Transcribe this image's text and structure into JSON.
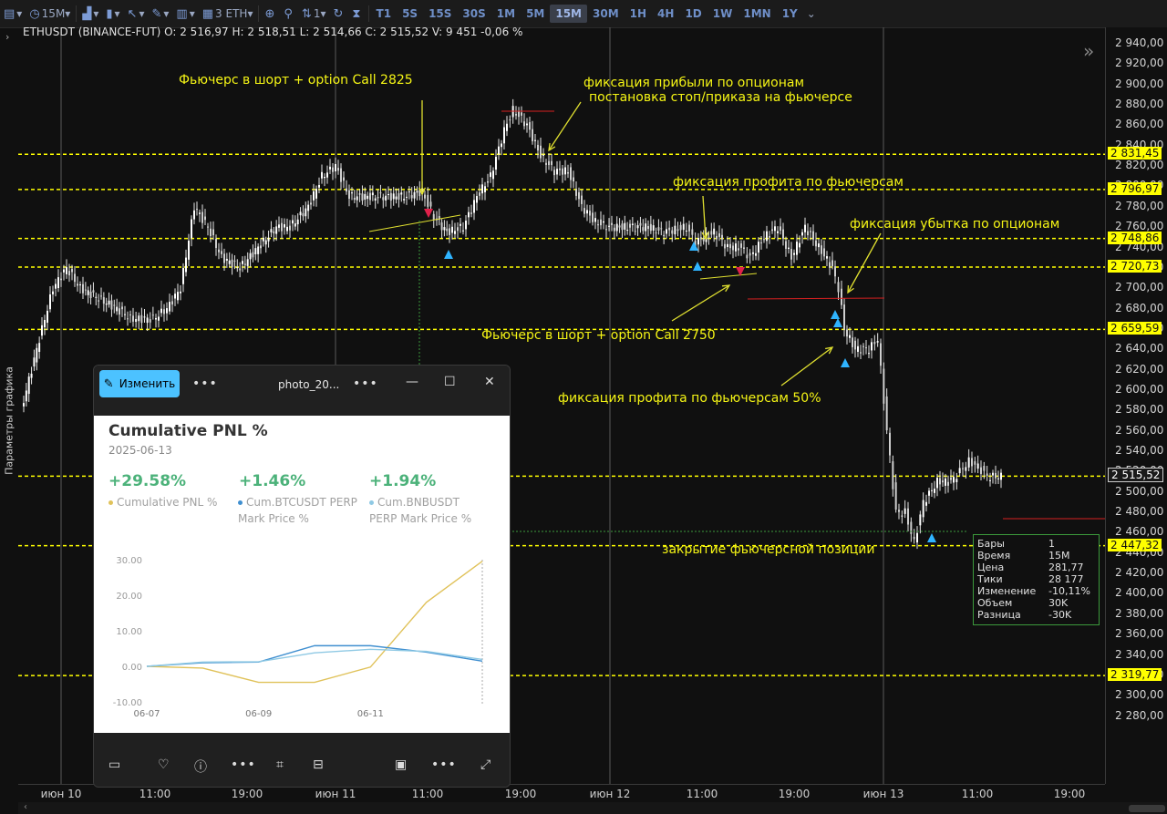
{
  "toolbar": {
    "interval": "15M",
    "quantity": "3 ETH",
    "menu_count": "1",
    "timeframes": [
      "T1",
      "5S",
      "15S",
      "30S",
      "1M",
      "5M",
      "15M",
      "30M",
      "1H",
      "4H",
      "1D",
      "1W",
      "1MN",
      "1Y"
    ],
    "active_timeframe": "15M"
  },
  "sidebar": {
    "label": "Параметры графика"
  },
  "symbol_info": "ETHUSDT (BINANCE-FUT) O: 2 516,97  H: 2 518,51  L: 2 514,66  C: 2 515,52  V: 9 451  -0,06 %",
  "price_axis": {
    "labels": [
      "2 940,00",
      "2 920,00",
      "2 900,00",
      "2 880,00",
      "2 860,00",
      "2 840,00",
      "2 820,00",
      "2 800,00",
      "2 780,00",
      "2 760,00",
      "2 740,00",
      "2 720,00",
      "2 700,00",
      "2 680,00",
      "2 660,00",
      "2 640,00",
      "2 620,00",
      "2 600,00",
      "2 580,00",
      "2 560,00",
      "2 540,00",
      "2 520,00",
      "2 500,00",
      "2 480,00",
      "2 460,00",
      "2 440,00",
      "2 420,00",
      "2 400,00",
      "2 380,00",
      "2 360,00",
      "2 340,00",
      "2 320,00",
      "2 300,00",
      "2 280,00"
    ],
    "levels": [
      "2 831,45",
      "2 796,97",
      "2 748,86",
      "2 720,73",
      "2 659,59",
      "2 447,32",
      "2 319,77"
    ],
    "current": "2 515,52"
  },
  "time_axis": [
    "июн 10",
    "11:00",
    "19:00",
    "июн 11",
    "11:00",
    "19:00",
    "июн 12",
    "11:00",
    "19:00",
    "июн 13",
    "11:00",
    "19:00"
  ],
  "annotations": [
    "Фьючерс в шорт + option Call 2825",
    "фиксация прибыли по опционам",
    "постановка стоп/приказа на фьючерсе",
    "фиксация профита по фьючерсам",
    "фиксация убытка по опционам",
    "Фьючерс в шорт + option Call 2750",
    "фиксация профита по фьючерсам 50%",
    "закрытие фьючерсной позиции"
  ],
  "info_box": [
    {
      "k": "Бары",
      "v": "1"
    },
    {
      "k": "Время",
      "v": "15M"
    },
    {
      "k": "Цена",
      "v": "281,77"
    },
    {
      "k": "Тики",
      "v": "28 177"
    },
    {
      "k": "Изменение",
      "v": "-10,11%"
    },
    {
      "k": "Объем",
      "v": "30K"
    },
    {
      "k": "Разница",
      "v": "-30K"
    }
  ],
  "viewer": {
    "edit_label": "Изменить",
    "file_name": "photo_20...",
    "image": {
      "title": "Cumulative PNL %",
      "date": "2025-06-13",
      "stats": [
        {
          "value": "+29.58%",
          "label": "Cumulative PNL %",
          "color": "#e0c25a"
        },
        {
          "value": "+1.46%",
          "label": "Cum.BTCUSDT PERP Mark Price %",
          "color": "#3f8fd0"
        },
        {
          "value": "+1.94%",
          "label": "Cum.BNBUSDT PERP Mark Price %",
          "color": "#8fc9e4"
        }
      ]
    }
  },
  "chart_data": {
    "type": "line",
    "x": [
      "06-07",
      "06-08",
      "06-09",
      "06-10",
      "06-11",
      "06-12",
      "06-13"
    ],
    "x_tick_labels": [
      "06-07",
      "06-09",
      "06-11"
    ],
    "y_tick_labels": [
      "30.00",
      "20.00",
      "10.00",
      "0.00",
      "-10.00"
    ],
    "ylim": [
      -10,
      30
    ],
    "series": [
      {
        "name": "Cumulative PNL %",
        "color": "#e0c25a",
        "values": [
          0,
          -0.5,
          -4.5,
          -4.5,
          -0.2,
          18,
          29.58
        ]
      },
      {
        "name": "Cum.BTCUSDT PERP Mark Price %",
        "color": "#3f8fd0",
        "values": [
          0,
          1,
          1.2,
          5.8,
          5.8,
          4,
          1.46
        ]
      },
      {
        "name": "Cum.BNBUSDT PERP Mark Price %",
        "color": "#8fc9e4",
        "values": [
          0,
          1.2,
          1.3,
          3.8,
          4.8,
          4.2,
          1.94
        ]
      }
    ]
  }
}
